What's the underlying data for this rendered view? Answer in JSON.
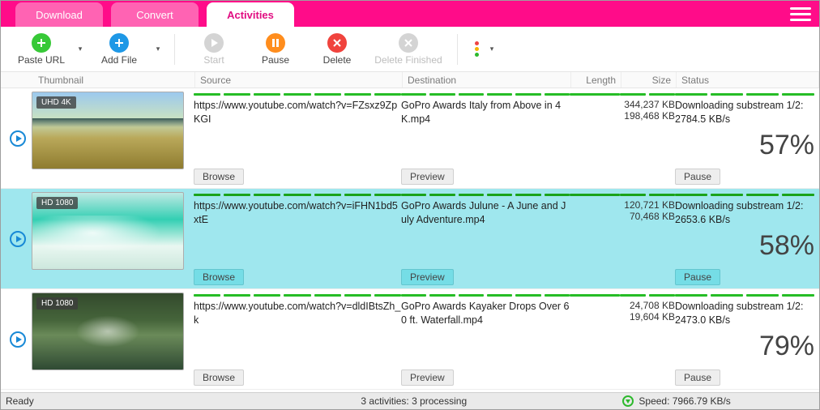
{
  "tabs": {
    "download": "Download",
    "convert": "Convert",
    "activities": "Activities"
  },
  "toolbar": {
    "paste_url": "Paste URL",
    "add_file": "Add File",
    "start": "Start",
    "pause": "Pause",
    "delete": "Delete",
    "delete_finished": "Delete Finished"
  },
  "columns": {
    "thumbnail": "Thumbnail",
    "source": "Source",
    "destination": "Destination",
    "length": "Length",
    "size": "Size",
    "status": "Status"
  },
  "buttons": {
    "browse": "Browse",
    "preview": "Preview",
    "pause": "Pause"
  },
  "rows": [
    {
      "badge": "UHD 4K",
      "source": "https://www.youtube.com/watch?v=FZsxz9ZpKGI",
      "destination": "GoPro Awards  Italy from Above in 4K.mp4",
      "size1": "344,237 KB",
      "size2": "198,468 KB",
      "status_line": "Downloading substream 1/2:",
      "speed": "2784.5 KB/s",
      "percent": "57%"
    },
    {
      "badge": "HD 1080",
      "source": "https://www.youtube.com/watch?v=iFHN1bd5xtE",
      "destination": "GoPro Awards  Julune - A June and July Adventure.mp4",
      "size1": "120,721 KB",
      "size2": "70,468 KB",
      "status_line": "Downloading substream 1/2:",
      "speed": "2653.6 KB/s",
      "percent": "58%"
    },
    {
      "badge": "HD 1080",
      "source": "https://www.youtube.com/watch?v=dldIBtsZh_k",
      "destination": "GoPro Awards  Kayaker Drops Over 60 ft. Waterfall.mp4",
      "size1": "24,708 KB",
      "size2": "19,604 KB",
      "status_line": "Downloading substream 1/2:",
      "speed": "2473.0 KB/s",
      "percent": "79%"
    }
  ],
  "statusbar": {
    "ready": "Ready",
    "activities": "3 activities: 3 processing",
    "speed": "Speed: 7966.79 KB/s"
  }
}
